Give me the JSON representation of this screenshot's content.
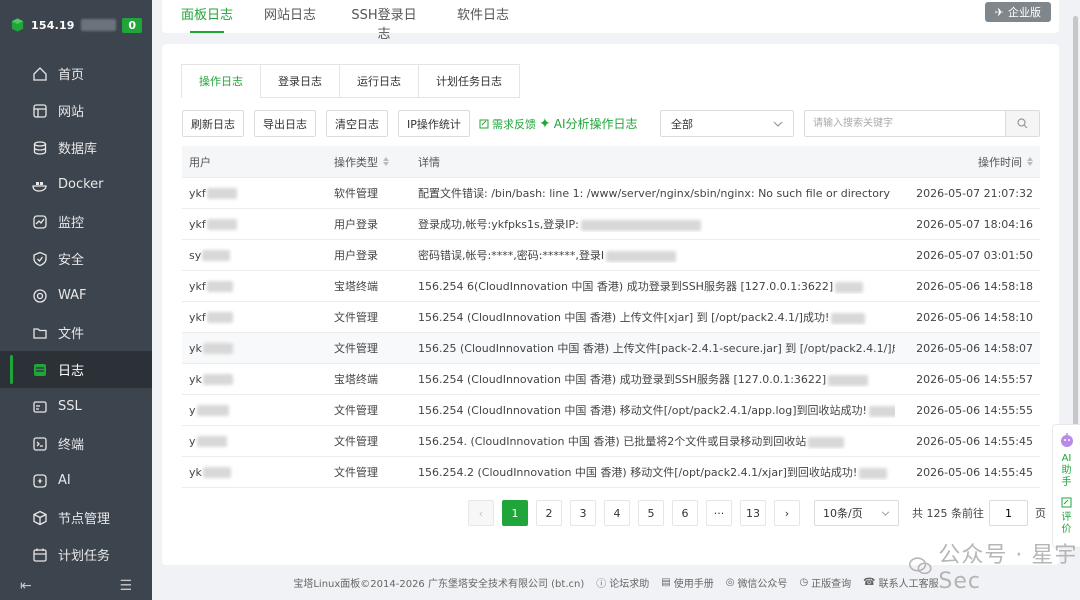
{
  "sidebar": {
    "ip": "154.19",
    "badge": "0",
    "items": [
      {
        "label": "首页",
        "icon": "home-icon"
      },
      {
        "label": "网站",
        "icon": "website-icon"
      },
      {
        "label": "数据库",
        "icon": "database-icon"
      },
      {
        "label": "Docker",
        "icon": "docker-icon"
      },
      {
        "label": "监控",
        "icon": "monitor-icon"
      },
      {
        "label": "安全",
        "icon": "shield-icon"
      },
      {
        "label": "WAF",
        "icon": "waf-icon"
      },
      {
        "label": "文件",
        "icon": "folder-icon"
      },
      {
        "label": "日志",
        "icon": "log-icon"
      },
      {
        "label": "SSL",
        "icon": "ssl-icon"
      },
      {
        "label": "终端",
        "icon": "terminal-icon"
      },
      {
        "label": "AI",
        "icon": "ai-icon"
      },
      {
        "label": "节点管理",
        "icon": "node-icon"
      },
      {
        "label": "计划任务",
        "icon": "calendar-icon"
      }
    ],
    "active_index": 8
  },
  "topbar": {
    "tabs": [
      "面板日志",
      "网站日志",
      "SSH登录日志",
      "软件日志"
    ],
    "active_tab": 0,
    "enterprise_label": "企业版"
  },
  "subtabs": {
    "tabs": [
      "操作日志",
      "登录日志",
      "运行日志",
      "计划任务日志"
    ],
    "active_tab": 0
  },
  "toolbar": {
    "refresh": "刷新日志",
    "export": "导出日志",
    "clear": "清空日志",
    "ip_stats": "IP操作统计",
    "feedback": "需求反馈",
    "ai_analyze": "AI分析操作日志",
    "filter_value": "全部",
    "search_placeholder": "请输入搜索关键字"
  },
  "table": {
    "headers": {
      "user": "用户",
      "type": "操作类型",
      "detail": "详情",
      "time": "操作时间"
    },
    "rows": [
      {
        "user": "ykf",
        "type": "软件管理",
        "detail": "配置文件错误: /bin/bash: line 1: /www/server/nginx/sbin/nginx: No such file or directory",
        "time": "2026-05-07 21:07:32"
      },
      {
        "user": "ykf",
        "type": "用户登录",
        "detail": "登录成功,帐号:ykfpks1s,登录IP:",
        "time": "2026-05-07 18:04:16"
      },
      {
        "user": "sy",
        "type": "用户登录",
        "detail": "密码错误,帐号:****,密码:******,登录I",
        "time": "2026-05-07 03:01:50"
      },
      {
        "user": "ykf",
        "type": "宝塔终端",
        "detail": "156.254 6(CloudInnovation 中国 香港) 成功登录到SSH服务器 [127.0.0.1:3622]",
        "time": "2026-05-06 14:58:18"
      },
      {
        "user": "ykf",
        "type": "文件管理",
        "detail": "156.254 (CloudInnovation 中国 香港) 上传文件[xjar] 到 [/opt/pack2.4.1/]成功!",
        "time": "2026-05-06 14:58:10"
      },
      {
        "user": "yk",
        "type": "文件管理",
        "detail": "156.25 (CloudInnovation 中国 香港) 上传文件[pack-2.4.1-secure.jar] 到 [/opt/pack2.4.1/]成功!",
        "time": "2026-05-06 14:58:07"
      },
      {
        "user": "yk",
        "type": "宝塔终端",
        "detail": "156.254 (CloudInnovation 中国 香港) 成功登录到SSH服务器 [127.0.0.1:3622]",
        "time": "2026-05-06 14:55:57"
      },
      {
        "user": "y",
        "type": "文件管理",
        "detail": "156.254 (CloudInnovation 中国 香港) 移动文件[/opt/pack2.4.1/app.log]到回收站成功!",
        "time": "2026-05-06 14:55:55"
      },
      {
        "user": "y",
        "type": "文件管理",
        "detail": "156.254. (CloudInnovation 中国 香港) 已批量将2个文件或目录移动到回收站",
        "time": "2026-05-06 14:55:45"
      },
      {
        "user": "yk",
        "type": "文件管理",
        "detail": "156.254.2 (CloudInnovation 中国 香港) 移动文件[/opt/pack2.4.1/xjar]到回收站成功!",
        "time": "2026-05-06 14:55:45"
      }
    ]
  },
  "pagination": {
    "prev": "‹",
    "pages": [
      "1",
      "2",
      "3",
      "4",
      "5",
      "6",
      "···",
      "13"
    ],
    "next": "›",
    "active_page": "1",
    "per_page": "10条/页",
    "total": "共 125 条",
    "goto_label": "前往",
    "goto_value": "1",
    "page_suffix": "页"
  },
  "footer": {
    "copyright": "宝塔Linux面板©2014-2026 广东堡塔安全技术有限公司 (bt.cn)",
    "links": [
      "论坛求助",
      "使用手册",
      "微信公众号",
      "正版查询",
      "联系人工客服"
    ]
  },
  "side_widget": {
    "ai_label": "AI助手",
    "review_label": "评价"
  },
  "watermark": {
    "text": "公众号 · 星宇Sec"
  },
  "colors": {
    "accent": "#20a53a",
    "sidebar_bg": "#3c444d"
  }
}
